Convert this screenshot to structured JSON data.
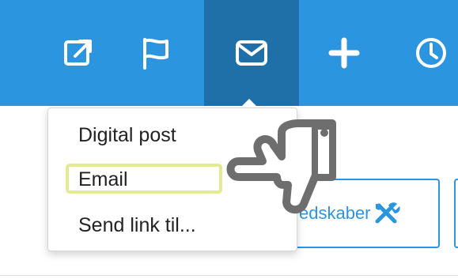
{
  "toolbar": {
    "buttons": [
      {
        "icon": "external-link-icon",
        "active": false
      },
      {
        "icon": "flag-icon",
        "active": false
      },
      {
        "icon": "envelope-icon",
        "active": true
      },
      {
        "icon": "plus-icon",
        "active": false
      },
      {
        "icon": "clock-icon",
        "active": false
      }
    ],
    "colors": {
      "bar": "#2b95e0",
      "active": "#1f6fa9",
      "icon": "#ffffff"
    }
  },
  "dropdown": {
    "items": [
      {
        "label": "Digital post"
      },
      {
        "label": "Email",
        "highlighted": true
      },
      {
        "label": "Send link til..."
      }
    ],
    "highlight_color": "#e4ea8f"
  },
  "content": {
    "partial_button_label": "edskaber",
    "partial_button_icon": "tools-icon",
    "accent": "#2b95e0"
  },
  "cursor": {
    "icon": "pointing-hand-cursor-icon"
  }
}
